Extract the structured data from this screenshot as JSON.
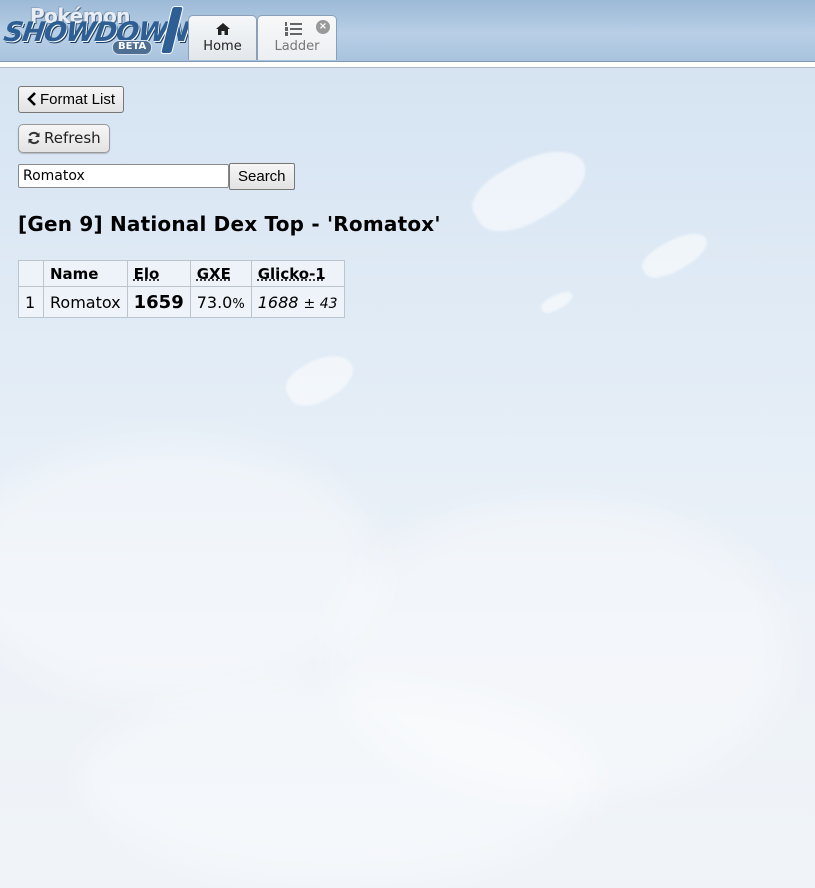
{
  "header": {
    "logo": {
      "line1": "Pokémon",
      "line2": "SHOWDOWN",
      "badge": "BETA"
    },
    "tabs": [
      {
        "label": "Home",
        "icon": "home-icon"
      },
      {
        "label": "Ladder",
        "icon": "list-ol-icon",
        "close": "×"
      }
    ]
  },
  "toolbar": {
    "format_list_label": "Format List",
    "refresh_label": "Refresh",
    "search_value": "Romatox",
    "search_label": "Search"
  },
  "ladder": {
    "title": "[Gen 9] National Dex Top - 'Romatox'",
    "columns": [
      "",
      "Name",
      "Elo",
      "GXE",
      "Glicko-1"
    ],
    "rows": [
      {
        "rank": "1",
        "name": "Romatox",
        "elo": "1659",
        "gxe": "73.0",
        "gxe_unit": "%",
        "glicko": "1688",
        "glicko_pm": "± 43"
      }
    ]
  },
  "colors": {
    "header_bg": "#b8cfe6",
    "logo_blue": "#2d5f94",
    "page_bg": "#e2ecf6"
  }
}
